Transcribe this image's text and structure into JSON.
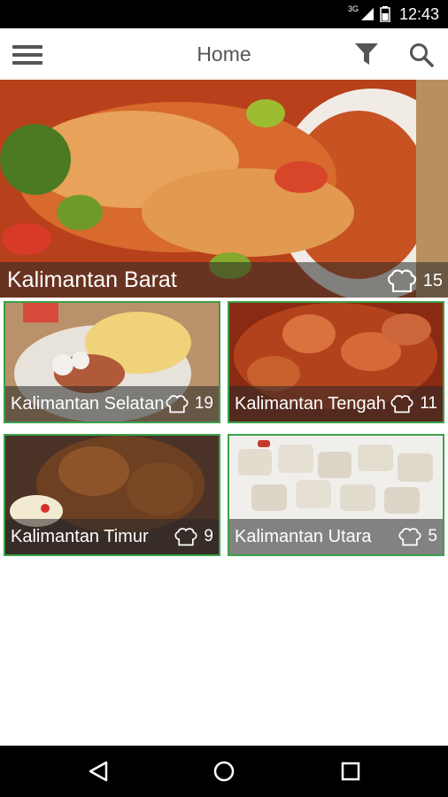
{
  "status_bar": {
    "time": "12:43",
    "network_label": "3G",
    "icons": [
      "signal-icon",
      "battery-icon"
    ]
  },
  "app_bar": {
    "title": "Home",
    "icons": [
      "menu-icon",
      "filter-icon",
      "search-icon"
    ]
  },
  "regions": [
    {
      "name": "Kalimantan Barat",
      "count": "15"
    },
    {
      "name": "Kalimantan Selatan",
      "count": "19"
    },
    {
      "name": "Kalimantan Tengah",
      "count": "11"
    },
    {
      "name": "Kalimantan Timur",
      "count": "9"
    },
    {
      "name": "Kalimantan Utara",
      "count": "5"
    }
  ],
  "count_icon": "chef-hat-icon",
  "colors": {
    "card_border": "#3aa24a",
    "caption_overlay": "rgba(40,40,40,0.55)"
  },
  "nav_bar": {
    "icons": [
      "back-icon",
      "home-icon",
      "recents-icon"
    ]
  }
}
